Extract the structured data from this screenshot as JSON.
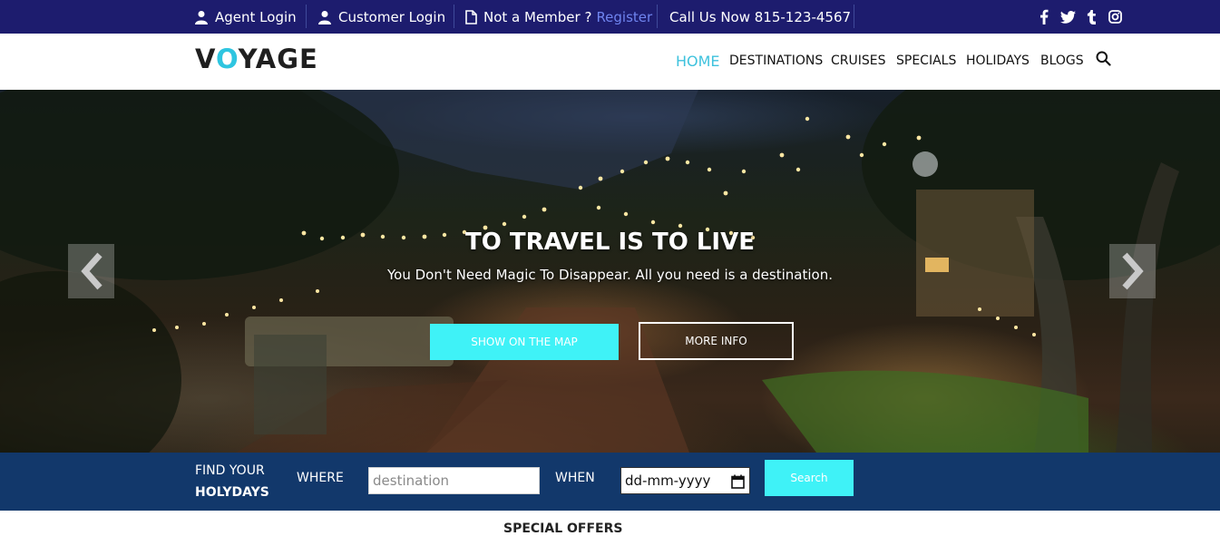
{
  "topbar": {
    "agent_login": "Agent Login",
    "customer_login": "Customer Login",
    "not_member": "Not a Member ?",
    "register": "Register",
    "call": "Call Us Now 815-123-4567",
    "social_icons": [
      "facebook-icon",
      "twitter-icon",
      "tumblr-icon",
      "instagram-icon"
    ]
  },
  "nav": {
    "logo_v": "V",
    "logo_o": "O",
    "logo_rest": "YAGE",
    "items": [
      "HOME",
      "DESTINATIONS",
      "CRUISES",
      "SPECIALS",
      "HOLIDAYS",
      "BLOGS"
    ],
    "active": "HOME"
  },
  "hero": {
    "title": "TO TRAVEL IS TO LIVE",
    "subtitle": "You Don't Need Magic To Disappear. All you need is a destination.",
    "btn_map": "SHOW ON THE MAP",
    "btn_info": "MORE INFO"
  },
  "search": {
    "find_line1": "FIND YOUR",
    "find_line2": "HOLYDAYS",
    "where_label": "WHERE",
    "where_placeholder": "destination",
    "when_label": "WHEN",
    "date_placeholder": "dd-mm-yyyy",
    "button": "Search"
  },
  "section": {
    "special_offers": "SPECIAL OFFERS"
  },
  "colors": {
    "topbar_bg": "#1d1c6e",
    "accent_cyan": "#3ff2f7",
    "nav_active": "#3ec2dd",
    "search_bg": "#12386b",
    "register_link": "#6f84ef"
  }
}
